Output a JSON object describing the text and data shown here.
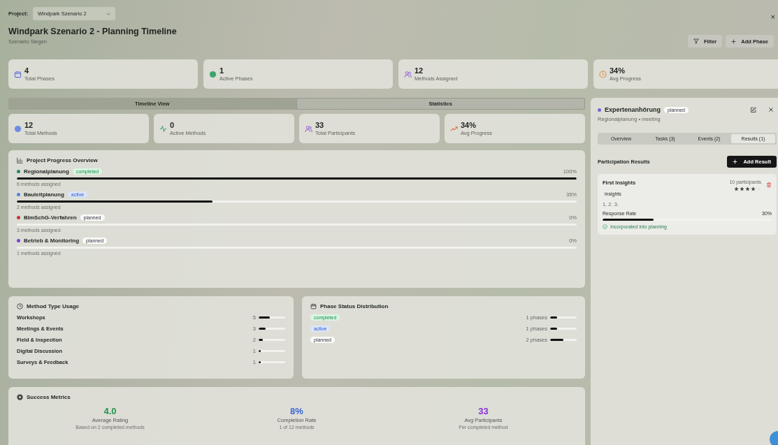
{
  "project": {
    "label": "Project:",
    "value": "Windpark Szenario 2"
  },
  "title": "Windpark Szenario 2 - Planning Timeline",
  "subtitle": "Szenario Siegen",
  "close": "×",
  "actions": [
    {
      "kind": "filter",
      "label": "Filter"
    },
    {
      "kind": "add",
      "label": "Add Phase"
    }
  ],
  "stats": [
    {
      "value": "4",
      "label": "Total Phases"
    },
    {
      "value": "1",
      "label": "Active Phases"
    },
    {
      "value": "12",
      "label": "Methods Assigned"
    },
    {
      "value": "34%",
      "label": "Avg Progress"
    }
  ],
  "tabs": [
    {
      "label": "Timeline View",
      "selected": false
    },
    {
      "label": "Statistics",
      "selected": true
    }
  ],
  "sub_stats": [
    {
      "value": "12",
      "label": "Total Methods"
    },
    {
      "value": "0",
      "label": "Active Methods"
    },
    {
      "value": "33",
      "label": "Total Participants"
    },
    {
      "value": "34%",
      "label": "Avg Progress"
    }
  ],
  "progress_overview": {
    "title": "Project Progress Overview",
    "phases": [
      {
        "name": "Regionalplanung",
        "color": "#1f8f5f",
        "status": "completed",
        "kind": "completed",
        "level": 1,
        "reading": "100%",
        "note": "6 methods assigned"
      },
      {
        "name": "Bauleitplanung",
        "color": "#4a86d8",
        "status": "active",
        "kind": "active",
        "level": 0.35,
        "reading": "35%",
        "note": "2 methods assigned"
      },
      {
        "name": "BImSchG-Verfahren",
        "color": "#c8333a",
        "status": "planned",
        "kind": "planned",
        "level": 0,
        "reading": "0%",
        "note": "3 methods assigned"
      },
      {
        "name": "Betrieb & Monitoring",
        "color": "#7a3fd6",
        "status": "planned",
        "kind": "planned",
        "level": 0,
        "reading": "0%",
        "note": "1 methods assigned"
      }
    ]
  },
  "method_usage": {
    "title": "Method Type Usage",
    "items": [
      {
        "name": "Workshops",
        "count": "5",
        "level": 0.42
      },
      {
        "name": "Meetings & Events",
        "count": "3",
        "level": 0.25
      },
      {
        "name": "Field & Inspection",
        "count": "2",
        "level": 0.17
      },
      {
        "name": "Digital Discussion",
        "count": "1",
        "level": 0.08
      },
      {
        "name": "Surveys & Feedback",
        "count": "1",
        "level": 0.08
      }
    ]
  },
  "status_distribution": {
    "title": "Phase Status Distribution",
    "items": [
      {
        "status": "completed",
        "kind": "completed",
        "count": "1 phases",
        "level": 0.25
      },
      {
        "status": "active",
        "kind": "active",
        "count": "1 phases",
        "level": 0.25
      },
      {
        "status": "planned",
        "kind": "planned",
        "count": "2 phases",
        "level": 0.5
      }
    ]
  },
  "success_metrics": {
    "title": "Success Metrics",
    "items": [
      {
        "value": "4.0",
        "color": "#23944f",
        "label": "Average Rating",
        "note": "Based on 2 completed methods"
      },
      {
        "value": "8%",
        "color": "#3b68d6",
        "label": "Completion Rate",
        "note": "1 of 12 methods"
      },
      {
        "value": "33",
        "color": "#8a2fe0",
        "label": "Avg Participants",
        "note": "Per completed method"
      }
    ]
  },
  "detail": {
    "title": "Expertenanhörung",
    "color": "#7a5fd6",
    "status": "planned",
    "kind": "planned",
    "subtitle": "Regionalplanung • meeting",
    "tabs": [
      {
        "label": "Overview",
        "selected": false
      },
      {
        "label": "Tasks (3)",
        "selected": false
      },
      {
        "label": "Events (2)",
        "selected": false
      },
      {
        "label": "Results (1)",
        "selected": true
      }
    ],
    "section": "Participation Results",
    "add_label": "Add Result",
    "results": [
      {
        "title": "First Insights",
        "tag": "insights",
        "participants": "10 participants",
        "stars": 4,
        "notes": "1. 2. 3.",
        "rate_label": "Response Rate",
        "level": 0.3,
        "reading": "30%",
        "incorporated": true,
        "incorporated_label": "Incorporated into planning"
      }
    ]
  }
}
